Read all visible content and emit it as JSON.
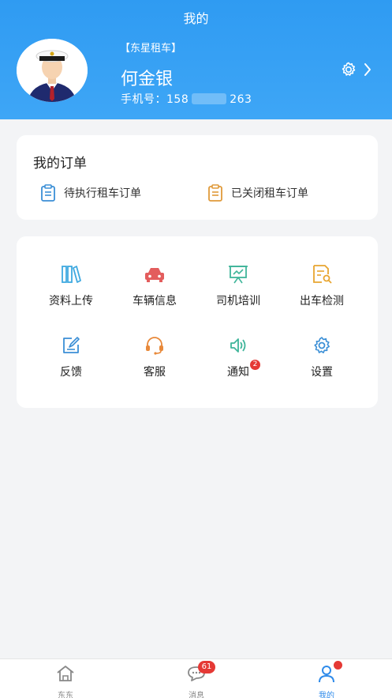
{
  "header": {
    "title": "我的",
    "company": "【东星租车】",
    "user_name": "何金银",
    "phone_label": "手机号：",
    "phone_prefix": "158",
    "phone_suffix": "263"
  },
  "orders": {
    "title": "我的订单",
    "items": [
      {
        "label": "待执行租车订单",
        "icon": "clipboard-icon",
        "color": "#3b8fd6"
      },
      {
        "label": "已关闭租车订单",
        "icon": "clipboard-icon",
        "color": "#e09a3a"
      }
    ]
  },
  "tools": [
    {
      "label": "资料上传",
      "icon": "books-icon",
      "color": "#3fa9e0"
    },
    {
      "label": "车辆信息",
      "icon": "car-icon",
      "color": "#e35d5d"
    },
    {
      "label": "司机培训",
      "icon": "presentation-icon",
      "color": "#3fb59a"
    },
    {
      "label": "出车检测",
      "icon": "document-search-icon",
      "color": "#e8a530"
    },
    {
      "label": "反馈",
      "icon": "edit-icon",
      "color": "#3b8fd6"
    },
    {
      "label": "客服",
      "icon": "headset-icon",
      "color": "#e8893a"
    },
    {
      "label": "通知",
      "icon": "speaker-icon",
      "color": "#3fb59a",
      "badge": "2"
    },
    {
      "label": "设置",
      "icon": "gear-icon",
      "color": "#3b8fd6"
    }
  ],
  "tabbar": {
    "items": [
      {
        "label": "东东",
        "icon": "home-icon"
      },
      {
        "label": "消息",
        "icon": "chat-icon",
        "badge": "61"
      },
      {
        "label": "我的",
        "icon": "user-icon",
        "active": true
      }
    ]
  },
  "colors": {
    "header_blue": "#2f9bf2",
    "active_tab": "#2f8bea",
    "badge_red": "#e53935"
  }
}
